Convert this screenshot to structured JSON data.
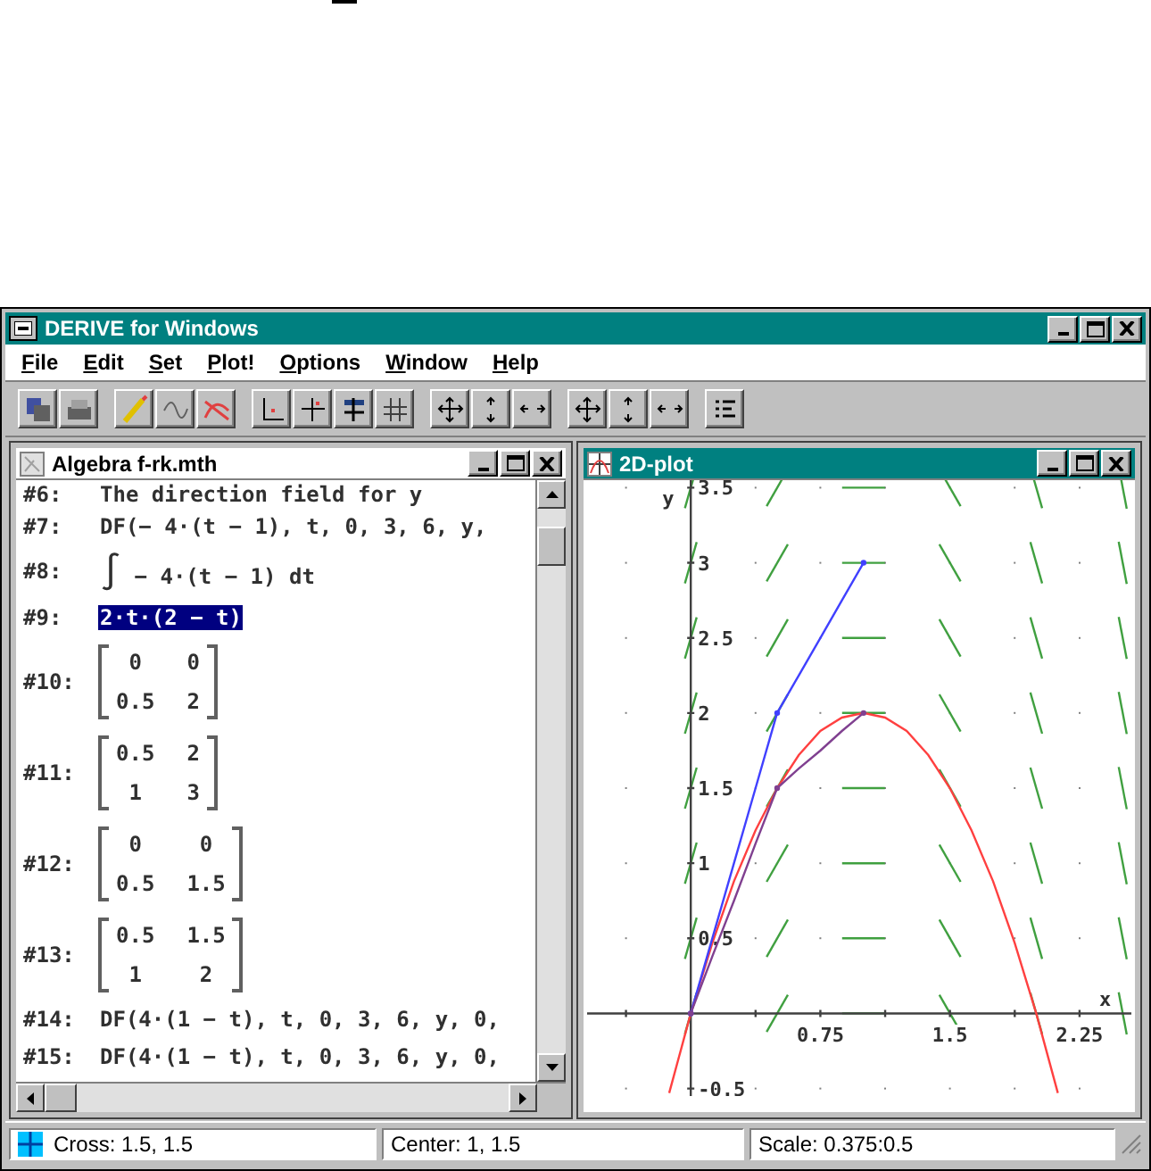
{
  "window": {
    "title": "DERIVE for Windows"
  },
  "menu": [
    {
      "label": "File"
    },
    {
      "label": "Edit"
    },
    {
      "label": "Set"
    },
    {
      "label": "Plot!"
    },
    {
      "label": "Options"
    },
    {
      "label": "Window"
    },
    {
      "label": "Help"
    }
  ],
  "algebra_window": {
    "title": "Algebra  f-rk.mth",
    "active": false,
    "rows": [
      {
        "kind": "text",
        "label": "#6:",
        "text": "  The direction field for y",
        "selected": false
      },
      {
        "kind": "text",
        "label": "#7:",
        "text": "DF(− 4·(t − 1), t, 0, 3, 6, y,",
        "selected": false
      },
      {
        "kind": "integral",
        "label": "#8:",
        "sign": "∫",
        "text": "− 4·(t − 1) dt",
        "selected": false
      },
      {
        "kind": "text",
        "label": "#9:",
        "text": "2·t·(2 − t)",
        "selected": true
      },
      {
        "kind": "matrix",
        "label": "#10:",
        "cells": [
          [
            "0",
            "0"
          ],
          [
            "0.5",
            "2"
          ]
        ],
        "selected": false
      },
      {
        "kind": "matrix",
        "label": "#11:",
        "cells": [
          [
            "0.5",
            "2"
          ],
          [
            "1",
            "3"
          ]
        ],
        "selected": false
      },
      {
        "kind": "matrix",
        "label": "#12:",
        "cells": [
          [
            "0",
            "0"
          ],
          [
            "0.5",
            "1.5"
          ]
        ],
        "selected": false
      },
      {
        "kind": "matrix",
        "label": "#13:",
        "cells": [
          [
            "0.5",
            "1.5"
          ],
          [
            "1",
            "2"
          ]
        ],
        "selected": false
      },
      {
        "kind": "text",
        "label": "#14:",
        "text": "DF(4·(1 − t), t, 0, 3, 6, y, 0,",
        "selected": false
      },
      {
        "kind": "text",
        "label": "#15:",
        "text": "DF(4·(1 − t), t, 0, 3, 6, y, 0,",
        "selected": false
      }
    ]
  },
  "plot_window": {
    "title": "2D-plot",
    "active": true,
    "chart_data": {
      "type": "line",
      "xlabel": "x",
      "ylabel": "y",
      "x": [
        -0.125,
        0,
        0.125,
        0.25,
        0.375,
        0.5,
        0.625,
        0.75,
        0.875,
        1,
        1.125,
        1.25,
        1.375,
        1.5,
        1.625,
        1.75,
        1.875,
        2,
        2.125
      ],
      "series": [
        {
          "color": "#ff4040",
          "values": [
            -0.53,
            0,
            0.47,
            0.88,
            1.22,
            1.5,
            1.72,
            1.88,
            1.97,
            2,
            1.97,
            1.88,
            1.72,
            1.5,
            1.22,
            0.88,
            0.47,
            0,
            -0.53
          ]
        },
        {
          "color": "#4040ff",
          "values": [
            null,
            0,
            0.5,
            1,
            1.5,
            2,
            2.25,
            2.5,
            2.75,
            3,
            null,
            null,
            null,
            null,
            null,
            null,
            null,
            null,
            null
          ]
        },
        {
          "color": "#804090",
          "values": [
            null,
            0,
            0.38,
            0.75,
            1.13,
            1.5,
            1.63,
            1.75,
            1.88,
            2,
            null,
            null,
            null,
            null,
            null,
            null,
            null,
            null,
            null
          ]
        }
      ],
      "xlim": [
        -0.6,
        2.55
      ],
      "ylim": [
        -0.55,
        3.55
      ],
      "xticks": [
        0.75,
        1.5,
        2.25
      ],
      "yticks": [
        -0.5,
        0.5,
        1,
        1.5,
        2,
        2.5,
        3,
        3.5
      ]
    }
  },
  "status_bar": {
    "cross": "Cross: 1.5, 1.5",
    "center": "Center: 1, 1.5",
    "scale": "Scale: 0.375:0.5"
  }
}
